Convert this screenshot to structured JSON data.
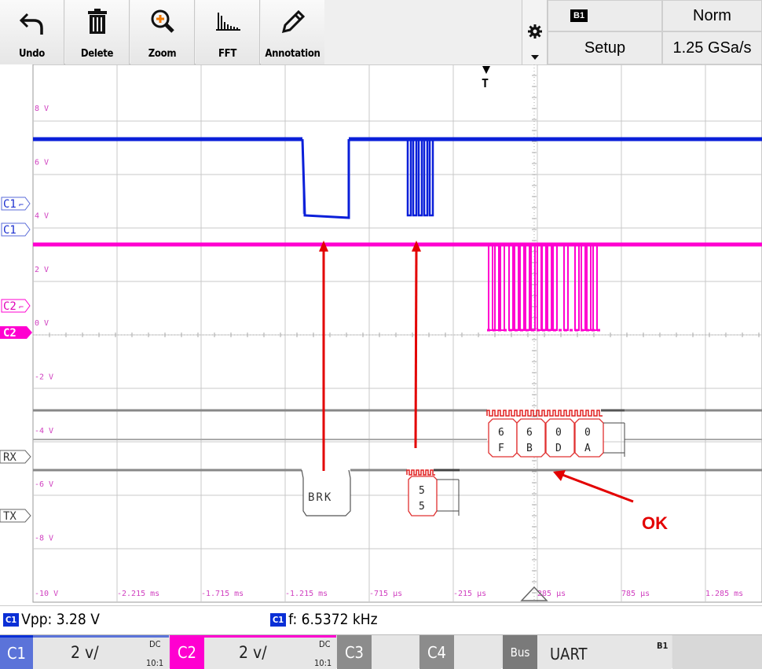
{
  "toolbar": {
    "undo_label": "Undo",
    "delete_label": "Delete",
    "zoom_label": "Zoom",
    "fft_label": "FFT",
    "annotation_label": "Annotation",
    "bus_badge": "B1",
    "trigger_mode": "Norm",
    "setup_label": "Setup",
    "sample_rate": "1.25 GSa/s"
  },
  "screen": {
    "trigger_marker": "T",
    "volt_labels": [
      "8 V",
      "6 V",
      "4 V",
      "2 V",
      "0 V",
      "-2 V",
      "-4 V",
      "-6 V",
      "-8 V",
      "-10 V"
    ],
    "time_labels": [
      "-2.215 ms",
      "-1.715 ms",
      "-1.215 ms",
      "-715 µs",
      "-215 µs",
      "285 µs",
      "785 µs",
      "1.285 ms"
    ],
    "channel_markers": {
      "c1_trig": "C1",
      "c1": "C1",
      "c2_trig": "C2",
      "c2": "C2",
      "rx": "RX",
      "tx": "TX"
    },
    "decode": {
      "brk": "BRK",
      "tx_byte": [
        "5",
        "5"
      ],
      "rx_bytes": [
        [
          "6",
          "F"
        ],
        [
          "6",
          "B"
        ],
        [
          "0",
          "D"
        ],
        [
          "0",
          "A"
        ]
      ]
    },
    "annotation_text": "OK"
  },
  "measurements": {
    "vpp_badge": "C1",
    "vpp": "Vpp: 3.28 V",
    "freq_badge": "C1",
    "freq": "f: 6.5372 kHz"
  },
  "bottom_bar": {
    "c1": {
      "tag": "C1",
      "scale": "2 v/",
      "coupling": "DC",
      "probe": "10:1"
    },
    "c2": {
      "tag": "C2",
      "scale": "2 v/",
      "coupling": "DC",
      "probe": "10:1"
    },
    "c3": {
      "tag": "C3"
    },
    "c4": {
      "tag": "C4"
    },
    "bus": {
      "tag": "Bus",
      "value": "UART",
      "badge": "B1"
    }
  },
  "colors": {
    "c1": "#0a1fd9",
    "c2": "#ff00d0",
    "annotation": "#e30000",
    "grid": "#c8c8c8"
  }
}
